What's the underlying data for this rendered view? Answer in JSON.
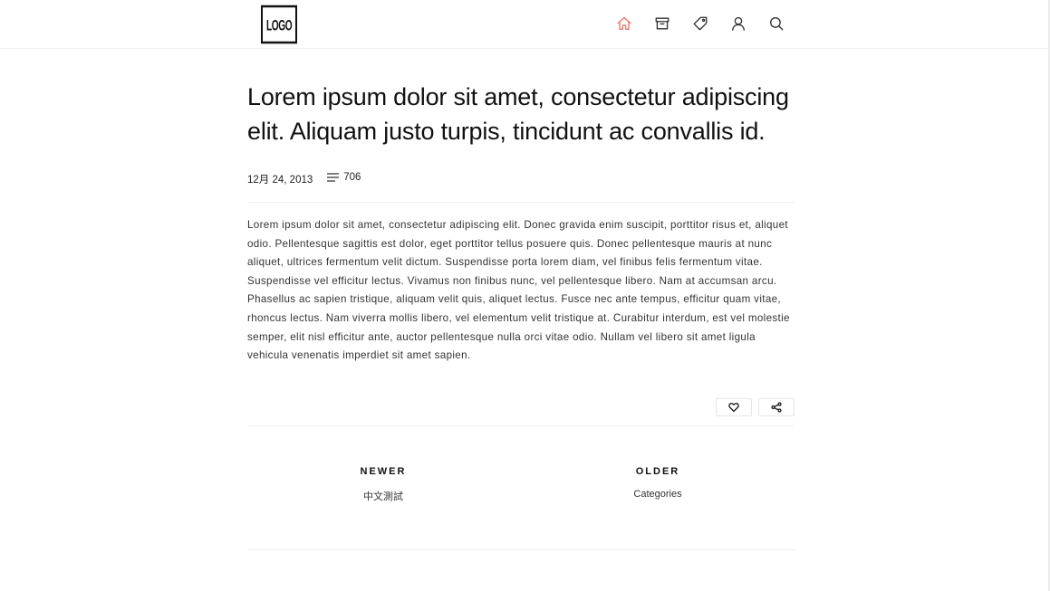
{
  "header": {
    "logo_text": "LOGO",
    "nav": [
      {
        "icon": "home-icon",
        "active": true
      },
      {
        "icon": "archive-icon",
        "active": false
      },
      {
        "icon": "tag-icon",
        "active": false
      },
      {
        "icon": "user-icon",
        "active": false
      },
      {
        "icon": "search-icon",
        "active": false
      }
    ]
  },
  "post": {
    "title": "Lorem ipsum dolor sit amet, consectetur adipiscing elit. Aliquam justo turpis, tincidunt ac convallis id.",
    "date": "12月 24, 2013",
    "word_count": "706",
    "body": "Lorem ipsum dolor sit amet, consectetur adipiscing elit. Donec gravida enim suscipit, porttitor risus et, aliquet odio. Pellentesque sagittis est dolor, eget porttitor tellus posuere quis. Donec pellentesque mauris at nunc aliquet, ultrices fermentum velit dictum. Suspendisse porta lorem diam, vel finibus felis fermentum vitae. Suspendisse vel efficitur lectus. Vivamus non finibus nunc, vel pellentesque libero. Nam at accumsan arcu. Phasellus ac sapien tristique, aliquam velit quis, aliquet lectus. Fusce nec ante tempus, efficitur quam vitae, rhoncus lectus. Nam viverra mollis libero, vel elementum velit tristique at. Curabitur interdum, est vel molestie semper, elit nisl efficitur ante, auctor pellentesque nulla orci vitae odio. Nullam vel libero sit amet ligula vehicula venenatis imperdiet sit amet sapien.",
    "actions": [
      {
        "icon": "heart-icon"
      },
      {
        "icon": "share-icon"
      }
    ]
  },
  "post_nav": {
    "newer_heading": "NEWER",
    "newer_link": "中文測試",
    "older_heading": "OLDER",
    "older_link": "Categories"
  },
  "colors": {
    "accent": "#e8766a",
    "icon": "#333333",
    "divider": "#efefef"
  }
}
